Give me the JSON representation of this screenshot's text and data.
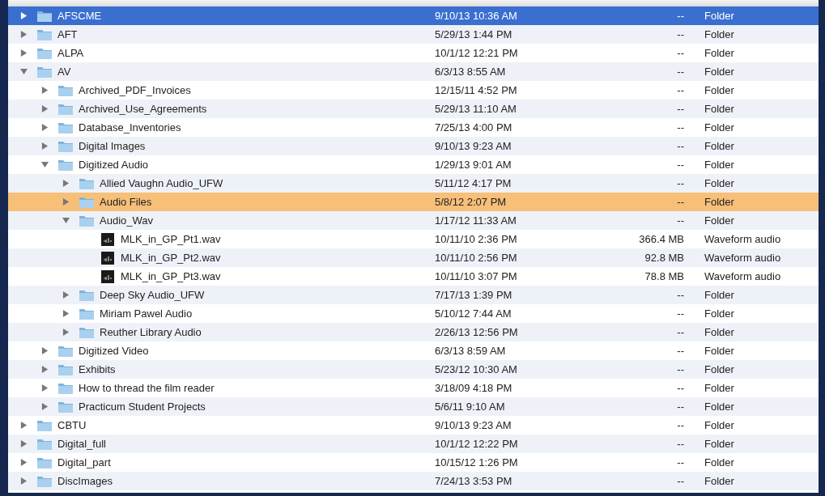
{
  "items": [
    {
      "kind": "folder",
      "name": "AFSCME",
      "date": "9/10/13 10:36 AM",
      "size": "--",
      "file_kind": "Folder",
      "expanded": false,
      "selected": true
    },
    {
      "kind": "folder",
      "name": "AFT",
      "date": "5/29/13 1:44 PM",
      "size": "--",
      "file_kind": "Folder",
      "expanded": false,
      "selected": false
    },
    {
      "kind": "folder",
      "name": "ALPA",
      "date": "10/1/12 12:21 PM",
      "size": "--",
      "file_kind": "Folder",
      "expanded": false,
      "selected": false
    },
    {
      "kind": "folder",
      "name": "AV",
      "date": "6/3/13 8:55 AM",
      "size": "--",
      "file_kind": "Folder",
      "expanded": true,
      "selected": false,
      "children": [
        {
          "kind": "folder",
          "name": "Archived_PDF_Invoices",
          "date": "12/15/11 4:52 PM",
          "size": "--",
          "file_kind": "Folder",
          "expanded": false,
          "selected": false
        },
        {
          "kind": "folder",
          "name": "Archived_Use_Agreements",
          "date": "5/29/13 11:10 AM",
          "size": "--",
          "file_kind": "Folder",
          "expanded": false,
          "selected": false
        },
        {
          "kind": "folder",
          "name": "Database_Inventories",
          "date": "7/25/13 4:00 PM",
          "size": "--",
          "file_kind": "Folder",
          "expanded": false,
          "selected": false
        },
        {
          "kind": "folder",
          "name": "Digital Images",
          "date": "9/10/13 9:23 AM",
          "size": "--",
          "file_kind": "Folder",
          "expanded": false,
          "selected": false
        },
        {
          "kind": "folder",
          "name": "Digitized Audio",
          "date": "1/29/13 9:01 AM",
          "size": "--",
          "file_kind": "Folder",
          "expanded": true,
          "selected": false,
          "children": [
            {
              "kind": "folder",
              "name": "Allied Vaughn Audio_UFW",
              "date": "5/11/12 4:17 PM",
              "size": "--",
              "file_kind": "Folder",
              "expanded": false,
              "selected": false
            },
            {
              "kind": "folder",
              "name": "Audio Files",
              "date": "5/8/12 2:07 PM",
              "size": "--",
              "file_kind": "Folder",
              "expanded": false,
              "selected": false,
              "color": "#f7bf78"
            },
            {
              "kind": "folder",
              "name": "Audio_Wav",
              "date": "1/17/12 11:33 AM",
              "size": "--",
              "file_kind": "Folder",
              "expanded": true,
              "selected": false,
              "children": [
                {
                  "kind": "audio",
                  "name": "MLK_in_GP_Pt1.wav",
                  "date": "10/11/10 2:36 PM",
                  "size": "366.4 MB",
                  "file_kind": "Waveform audio",
                  "selected": false
                },
                {
                  "kind": "audio",
                  "name": "MLK_in_GP_Pt2.wav",
                  "date": "10/11/10 2:56 PM",
                  "size": "92.8 MB",
                  "file_kind": "Waveform audio",
                  "selected": false
                },
                {
                  "kind": "audio",
                  "name": "MLK_in_GP_Pt3.wav",
                  "date": "10/11/10 3:07 PM",
                  "size": "78.8 MB",
                  "file_kind": "Waveform audio",
                  "selected": false
                }
              ]
            },
            {
              "kind": "folder",
              "name": "Deep Sky Audio_UFW",
              "date": "7/17/13 1:39 PM",
              "size": "--",
              "file_kind": "Folder",
              "expanded": false,
              "selected": false
            },
            {
              "kind": "folder",
              "name": "Miriam Pawel Audio",
              "date": "5/10/12 7:44 AM",
              "size": "--",
              "file_kind": "Folder",
              "expanded": false,
              "selected": false
            },
            {
              "kind": "folder",
              "name": "Reuther Library Audio",
              "date": "2/26/13 12:56 PM",
              "size": "--",
              "file_kind": "Folder",
              "expanded": false,
              "selected": false
            }
          ]
        },
        {
          "kind": "folder",
          "name": "Digitized Video",
          "date": "6/3/13 8:59 AM",
          "size": "--",
          "file_kind": "Folder",
          "expanded": false,
          "selected": false
        },
        {
          "kind": "folder",
          "name": "Exhibits",
          "date": "5/23/12 10:30 AM",
          "size": "--",
          "file_kind": "Folder",
          "expanded": false,
          "selected": false
        },
        {
          "kind": "folder",
          "name": "How to thread the film reader",
          "date": "3/18/09 4:18 PM",
          "size": "--",
          "file_kind": "Folder",
          "expanded": false,
          "selected": false
        },
        {
          "kind": "folder",
          "name": "Practicum Student Projects",
          "date": "5/6/11 9:10 AM",
          "size": "--",
          "file_kind": "Folder",
          "expanded": false,
          "selected": false
        }
      ]
    },
    {
      "kind": "folder",
      "name": "CBTU",
      "date": "9/10/13 9:23 AM",
      "size": "--",
      "file_kind": "Folder",
      "expanded": false,
      "selected": false
    },
    {
      "kind": "folder",
      "name": "Digital_full",
      "date": "10/1/12 12:22 PM",
      "size": "--",
      "file_kind": "Folder",
      "expanded": false,
      "selected": false
    },
    {
      "kind": "folder",
      "name": "Digital_part",
      "date": "10/15/12 1:26 PM",
      "size": "--",
      "file_kind": "Folder",
      "expanded": false,
      "selected": false
    },
    {
      "kind": "folder",
      "name": "DiscImages",
      "date": "7/24/13 3:53 PM",
      "size": "--",
      "file_kind": "Folder",
      "expanded": false,
      "selected": false
    }
  ]
}
